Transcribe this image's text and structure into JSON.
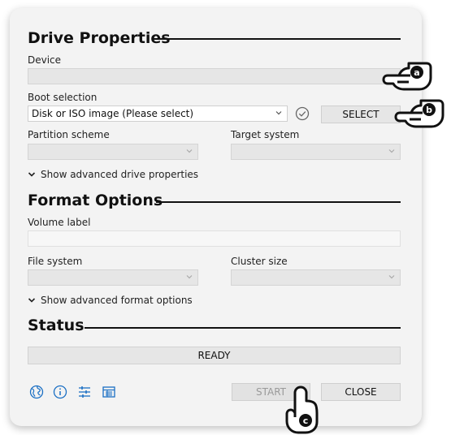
{
  "drive_properties": {
    "title": "Drive Properties",
    "device_label": "Device",
    "device_value": "",
    "boot_selection_label": "Boot selection",
    "boot_selection_value": "Disk or ISO image (Please select)",
    "select_button": "SELECT",
    "partition_scheme_label": "Partition scheme",
    "target_system_label": "Target system",
    "advanced_toggle": "Show advanced drive properties"
  },
  "format_options": {
    "title": "Format Options",
    "volume_label_label": "Volume label",
    "volume_label_value": "",
    "file_system_label": "File system",
    "cluster_size_label": "Cluster size",
    "advanced_toggle": "Show advanced format options"
  },
  "status": {
    "title": "Status",
    "text": "READY"
  },
  "footer": {
    "start_button": "START",
    "close_button": "CLOSE",
    "icons": [
      "globe-icon",
      "info-icon",
      "settings-sliders-icon",
      "log-icon"
    ]
  },
  "annotations": {
    "a": "a",
    "b": "b",
    "c": "c"
  },
  "colors": {
    "accent": "#1a6fc4",
    "panel": "#f3f3f3",
    "field": "#e6e6e6"
  }
}
